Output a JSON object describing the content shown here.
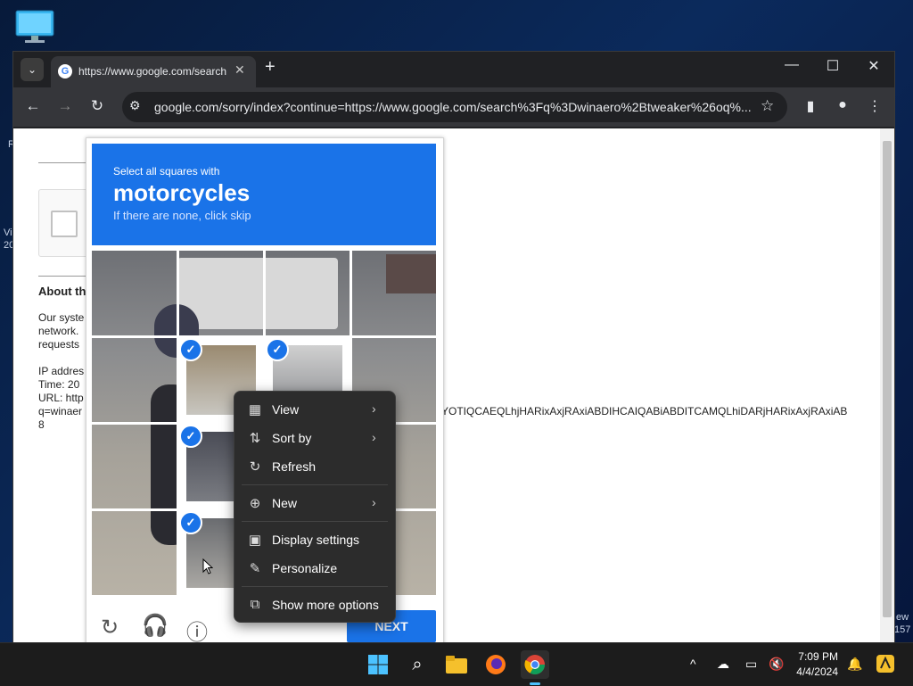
{
  "desktop": {
    "icon": "monitor-icon",
    "edge_text_left_1": "R",
    "edge_text_left_2": "Vi",
    "edge_text_left_3": "20",
    "edge_text_right_1": "ew",
    "edge_text_right_2": "157"
  },
  "browser": {
    "tab": {
      "title": "https://www.google.com/search",
      "close": "✕"
    },
    "new_tab": "+",
    "window_controls": {
      "minimize": "—",
      "maximize": "☐",
      "close": "✕"
    },
    "url": "google.com/sorry/index?continue=https://www.google.com/search%3Fq%3Dwinaero%2Btweaker%26oq%..."
  },
  "page": {
    "about_heading": "About th",
    "body_lines": [
      "Our syste",
      "network.",
      "requests"
    ],
    "ip_lines": [
      "IP addres",
      "Time: 20",
      "URL: http",
      "q=winaer",
      "8"
    ],
    "long_token": "YOTIQCAEQLhjHARixAxjRAxiABDIHCAIQABiABDITCAMQLhiDARjHARixAxjRAxiAB"
  },
  "captcha": {
    "instruction": "Select all squares with",
    "target": "motorcycles",
    "hint": "If there are none, click skip",
    "next_label": "NEXT",
    "selected_cells": [
      [
        1,
        1
      ],
      [
        1,
        2
      ],
      [
        2,
        1
      ],
      [
        3,
        1
      ]
    ]
  },
  "context_menu": {
    "items": [
      {
        "icon": "view-grid-icon",
        "label": "View",
        "submenu": true
      },
      {
        "icon": "sort-icon",
        "label": "Sort by",
        "submenu": true
      },
      {
        "icon": "refresh-icon",
        "label": "Refresh",
        "submenu": false
      },
      {
        "icon": "new-plus-icon",
        "label": "New",
        "submenu": true
      },
      {
        "icon": "display-settings-icon",
        "label": "Display settings",
        "submenu": false
      },
      {
        "icon": "personalize-brush-icon",
        "label": "Personalize",
        "submenu": false
      },
      {
        "icon": "show-more-options-icon",
        "label": "Show more options",
        "submenu": false
      }
    ]
  },
  "taskbar": {
    "time": "7:09 PM",
    "date": "4/4/2024"
  }
}
